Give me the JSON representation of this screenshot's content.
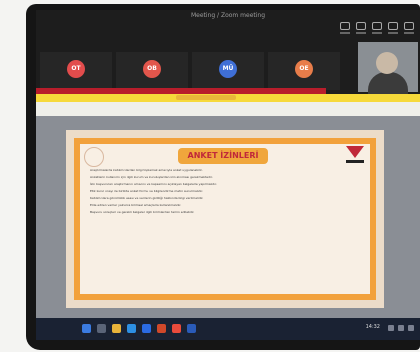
{
  "window": {
    "title": "Meeting / Zoom meeting"
  },
  "toolbar_icons": [
    "camera-icon",
    "participants-icon",
    "chat-icon",
    "share-icon",
    "record-icon"
  ],
  "participants": [
    {
      "color": "#e24c4c",
      "initials": "OT"
    },
    {
      "color": "#e2564c",
      "initials": "OB"
    },
    {
      "color": "#3f6fd6",
      "initials": "MÜ"
    },
    {
      "color": "#e87d4a",
      "initials": "OE"
    }
  ],
  "slide": {
    "title": "ANKET İZİNLERİ",
    "bullets": [
      "Araştırmalarda katılımcılardan bilgi toplamak amacıyla anket uygulanabilir.",
      "Anketlerin kullanımı için ilgili kurum ve kuruluşlardan izin alınması gerekmektedir.",
      "İzin başvuruları araştırmanın amacını ve kapsamını açıklayan belgelerle yapılmalıdır.",
      "Etik kurul onayı ile birlikte anket formu ve bilgilendirme metni sunulmalıdır.",
      "Katılımcılara gönüllülük esası ve verilerin gizliliği hakkında bilgi verilmelidir.",
      "Elde edilen veriler yalnızca bilimsel amaçlarla kullanılmalıdır.",
      "Başvuru süreçleri ve gerekli belgeler ilgili birimlerden temin edilebilir."
    ]
  },
  "taskbar": {
    "clock": "14:32"
  },
  "colors": {
    "accent": "#f0a63c",
    "title_red": "#c0283a",
    "share_bar": "#f6d93a"
  }
}
